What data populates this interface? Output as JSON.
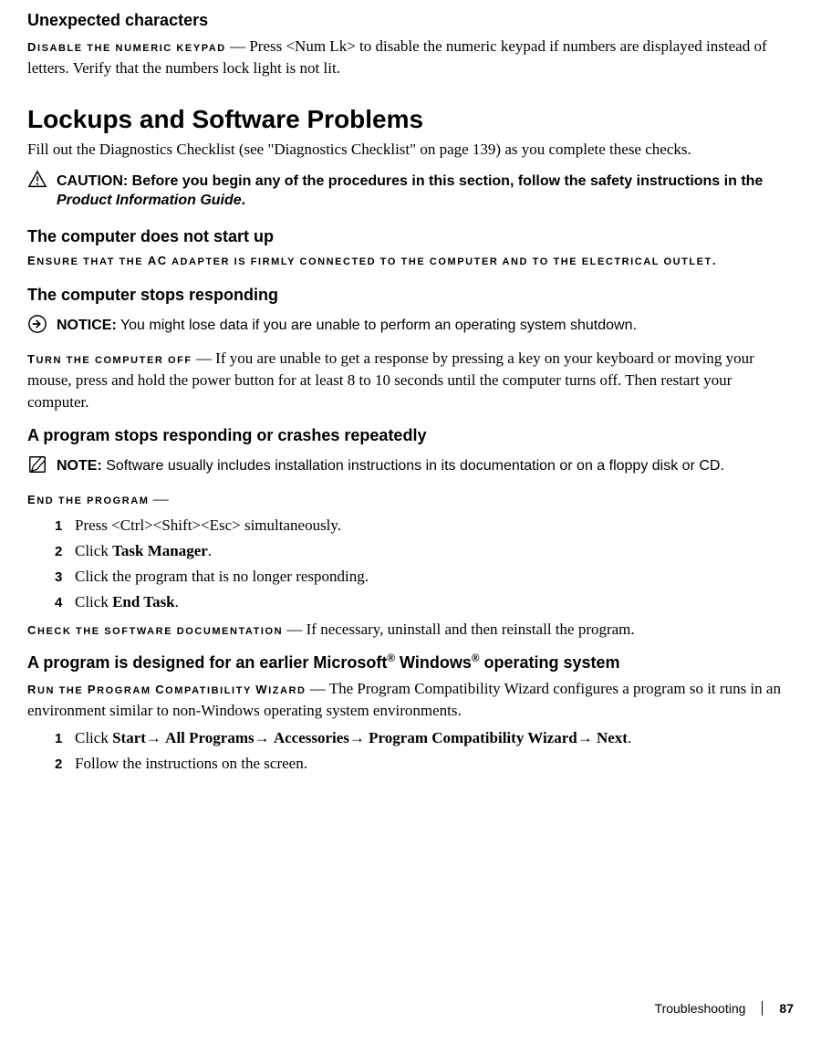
{
  "headers": {
    "unexpected": "Unexpected characters",
    "lockups": "Lockups and Software Problems",
    "notstart": "The computer does not start up",
    "stopsresp": "The computer stops responding",
    "programcrash": "A program stops responding or crashes repeatedly",
    "earlieros_prefix": "A program is designed for an earlier Microsoft",
    "earlieros_mid": " Windows",
    "earlieros_suffix": " operating system"
  },
  "labels": {
    "disable_keypad_prefix": "D",
    "disable_keypad_rest": "ISABLE THE NUMERIC KEYPAD",
    "dash": " — ",
    "ensure_ac_prefix": "E",
    "ensure_ac_mid1": "NSURE THAT THE ",
    "ensure_ac_ac": "AC",
    "ensure_ac_mid2": " ADAPTER IS FIRMLY CONNECTED TO THE COMPUTER AND TO THE ELECTRICAL OUTLET",
    "ensure_ac_end": ".",
    "turnoff_prefix": "T",
    "turnoff_rest": "URN THE COMPUTER OFF",
    "endprogram_prefix": "E",
    "endprogram_rest": "ND THE PROGRAM",
    "checksoft_prefix": "C",
    "checksoft_rest": "HECK THE SOFTWARE DOCUMENTATION",
    "runcompat_prefix": "R",
    "runcompat_mid1": "UN THE ",
    "runcompat_p": "P",
    "runcompat_mid2": "ROGRAM ",
    "runcompat_c": "C",
    "runcompat_mid3": "OMPATIBILITY ",
    "runcompat_w": "W",
    "runcompat_mid4": "IZARD"
  },
  "body": {
    "disable_keypad": "Press <Num Lk> to disable the numeric keypad if numbers are displayed instead of letters. Verify that the numbers lock light is not lit.",
    "lockups_intro": "Fill out the Diagnostics Checklist (see \"Diagnostics Checklist\" on page 139) as you complete these checks.",
    "caution_label": "CAUTION:",
    "caution_text": " Before you begin any of the procedures in this section, follow the safety instructions in the ",
    "caution_italic": "Product Information Guide",
    "caution_end": ".",
    "notice_label": "NOTICE:",
    "notice_text": " You might lose data if you are unable to perform an operating system shutdown.",
    "turnoff_text": "If you are unable to get a response by pressing a key on your keyboard or moving your mouse, press and hold the power button for at least 8 to 10 seconds until the computer turns off. Then restart your computer.",
    "note_label": "NOTE:",
    "note_text": " Software usually includes installation instructions in its documentation or on a floppy disk or CD.",
    "checksoft_text": " If necessary, uninstall and then reinstall the program.",
    "runcompat_text": "The Program Compatibility Wizard configures a program so it runs in an environment similar to non-Windows operating system environments."
  },
  "steps1": {
    "s1_a": "Press <Ctrl><Shift><Esc> simultaneously.",
    "s2_a": "Click ",
    "s2_b": "Task Manager",
    "s2_c": ".",
    "s3_a": "Click the program that is no longer responding.",
    "s4_a": "Click ",
    "s4_b": "End Task",
    "s4_c": "."
  },
  "steps2": {
    "s1_a": "Click ",
    "s1_b": "Start",
    "s1_c": "→ ",
    "s1_d": "All Programs",
    "s1_e": "→ ",
    "s1_f": "Accessories",
    "s1_g": "→ ",
    "s1_h": "Program Compatibility Wizard",
    "s1_i": "→ ",
    "s1_j": "Next",
    "s1_k": ".",
    "s2_a": "Follow the instructions on the screen."
  },
  "nums": {
    "n1": "1",
    "n2": "2",
    "n3": "3",
    "n4": "4"
  },
  "footer": {
    "section": "Troubleshooting",
    "page": "87"
  },
  "reg": "®"
}
